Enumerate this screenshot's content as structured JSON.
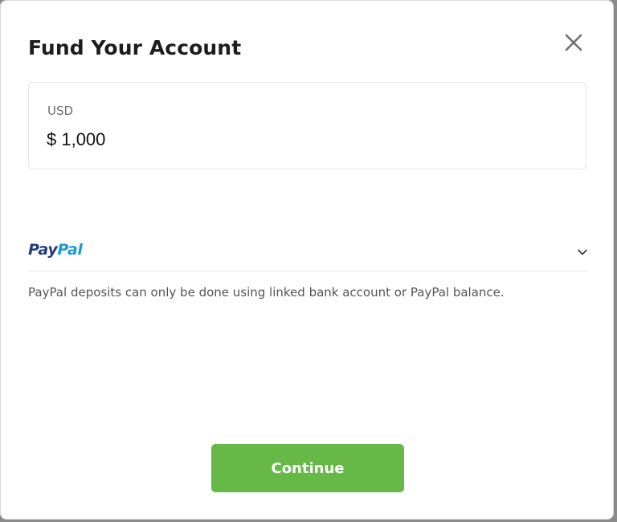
{
  "modal": {
    "title": "Fund Your Account",
    "close_icon": "close-icon"
  },
  "amount": {
    "currency_label": "USD",
    "value": "$ 1,000"
  },
  "payment_method": {
    "logo_part1": "Pay",
    "logo_part2": "Pal",
    "logo_colors": {
      "pay": "#253b80",
      "pal": "#179bd7"
    },
    "dropdown_icon": "chevron-down-icon",
    "note": "PayPal deposits can only be done using linked bank account or PayPal balance."
  },
  "actions": {
    "continue_label": "Continue",
    "continue_color": "#66b946"
  }
}
